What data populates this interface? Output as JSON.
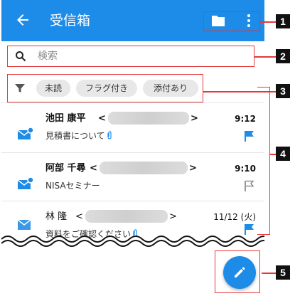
{
  "appbar": {
    "title": "受信箱",
    "back_icon": "back-arrow-icon",
    "folder_icon": "folder-icon",
    "more_icon": "more-vert-icon",
    "color": "#1d8be8"
  },
  "search": {
    "placeholder": "検索"
  },
  "filters": {
    "chips": [
      "未読",
      "フラグ付き",
      "添付あり"
    ]
  },
  "messages": [
    {
      "sender_last": "池田",
      "sender_first": "康平",
      "time": "9:12",
      "subject": "見積書について",
      "attachment": true,
      "flag": "filled",
      "unread": true,
      "bold": true
    },
    {
      "sender_last": "阿部",
      "sender_first": "千尋",
      "time": "9:10",
      "subject": "NISAセミナー",
      "attachment": false,
      "flag": "outline",
      "unread": true,
      "bold": true
    },
    {
      "sender_last": "林",
      "sender_first": "隆",
      "time": "11/12 (火)",
      "subject": "資料をご確認ください",
      "attachment": true,
      "flag": "filled",
      "unread": false,
      "bold": false
    }
  ],
  "email_brackets": {
    "open": "<",
    "close": ">"
  },
  "fab": {
    "icon": "pencil-icon"
  },
  "callouts": [
    "1",
    "2",
    "3",
    "4",
    "5"
  ],
  "colors": {
    "highlight": "#e23a3a",
    "accent": "#1d8be8"
  }
}
